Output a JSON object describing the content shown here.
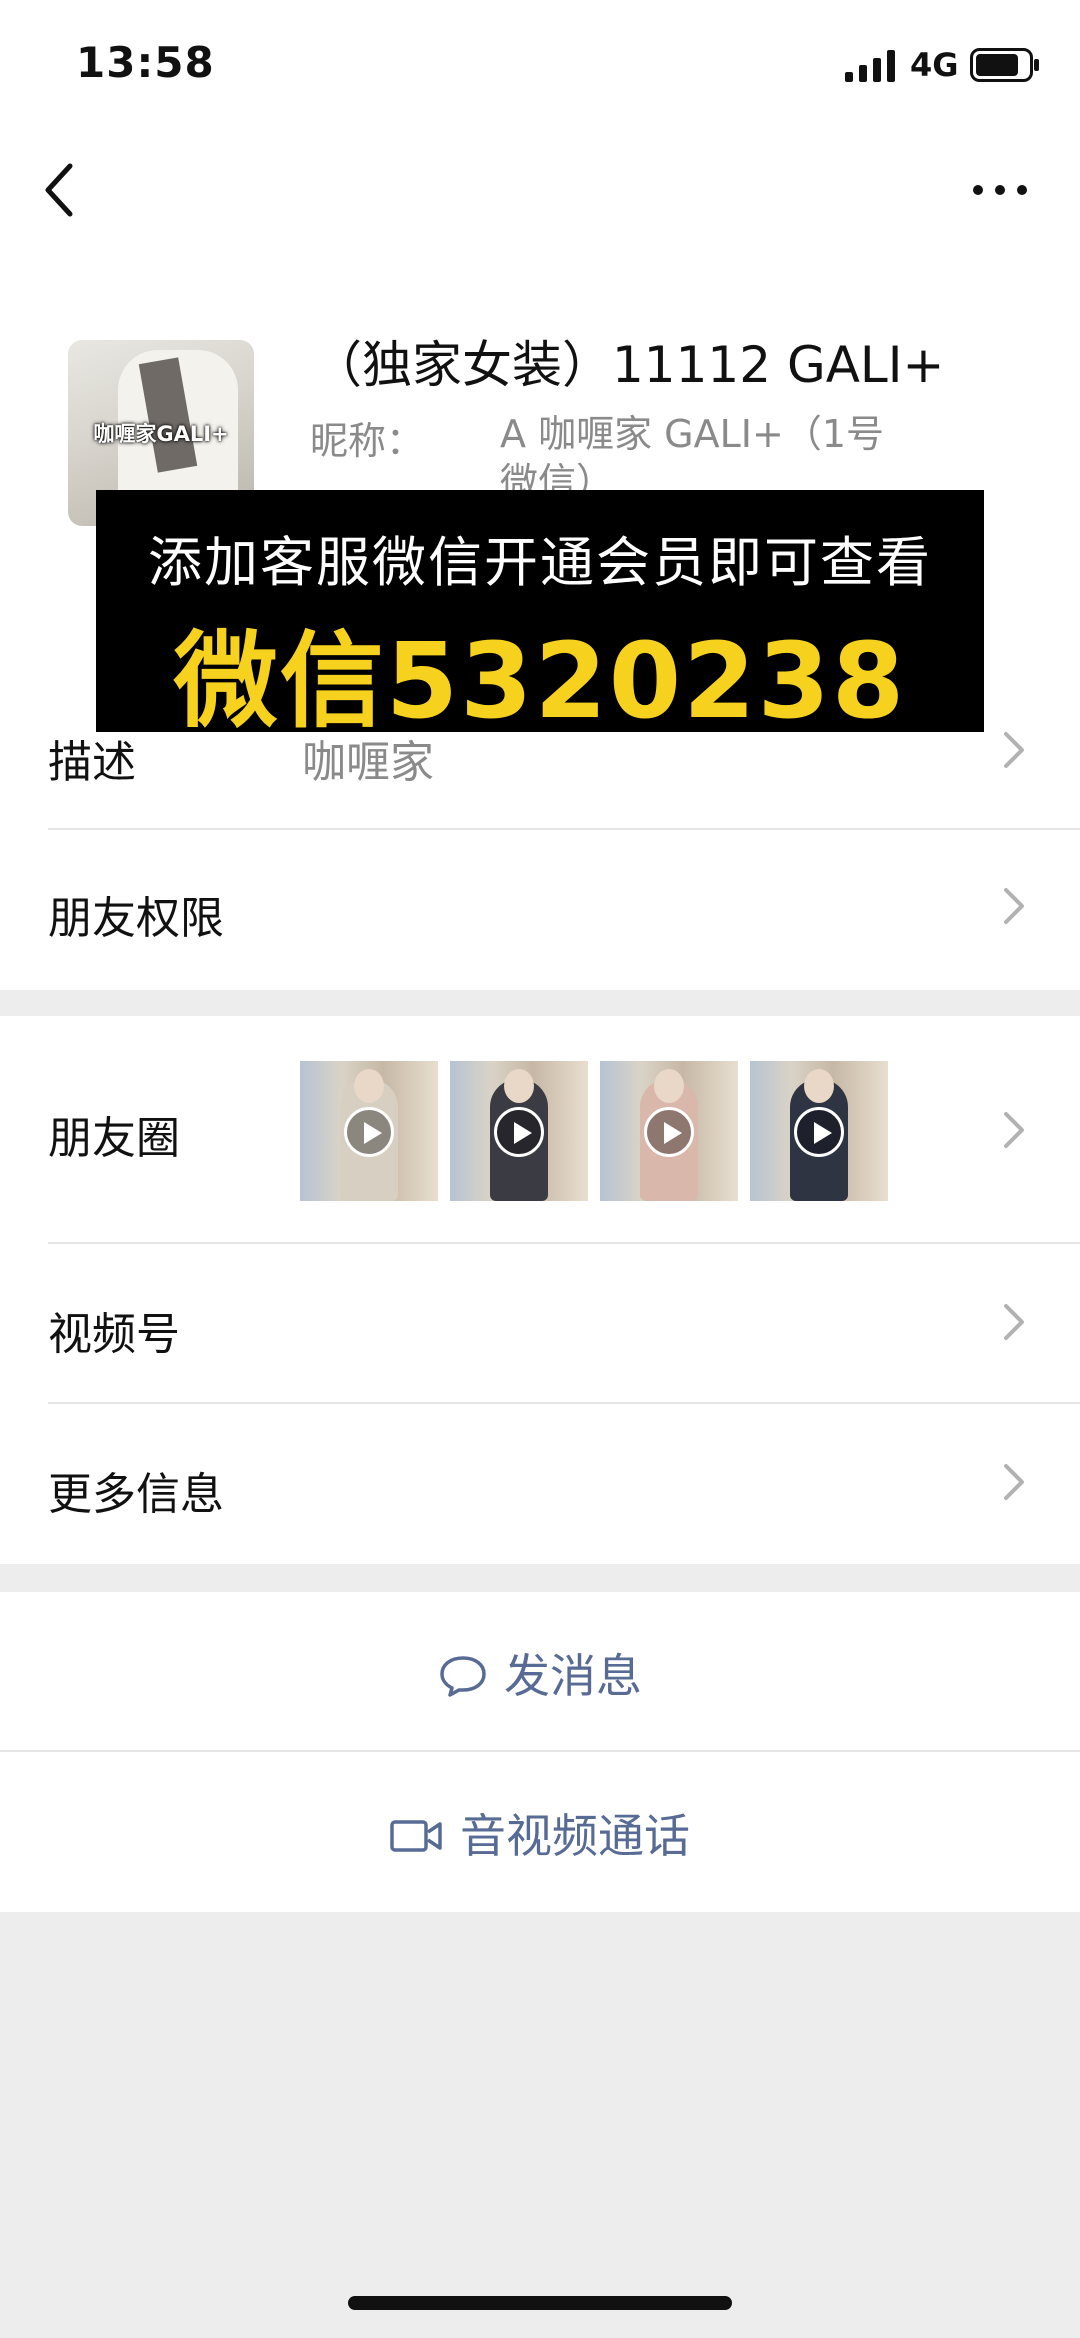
{
  "status_bar": {
    "time": "13:58",
    "network": "4G"
  },
  "nav": {
    "back_icon": "chevron-left-icon",
    "more_icon": "ellipsis-icon"
  },
  "profile": {
    "name": "（独家女装）11112 GALI+",
    "nickname_label": "昵称：",
    "nickname_value": "A 咖喱家 GALI+（1号微信）",
    "avatar_text": "咖喱家GALI+"
  },
  "banner": {
    "line1": "添加客服微信开通会员即可查看",
    "line2": "微信5320238",
    "text_color": "#f6d21f"
  },
  "rows": {
    "description": {
      "label": "描述",
      "value": "咖喱家"
    },
    "friend_permissions": {
      "label": "朋友权限"
    },
    "moments": {
      "label": "朋友圈",
      "thumbnail_count": 4
    },
    "channels": {
      "label": "视频号"
    },
    "more_info": {
      "label": "更多信息"
    }
  },
  "actions": {
    "message": {
      "label": "发消息",
      "icon": "chat-bubble-icon"
    },
    "call": {
      "label": "音视频通话",
      "icon": "video-camera-icon"
    },
    "accent_color": "#576b95"
  }
}
